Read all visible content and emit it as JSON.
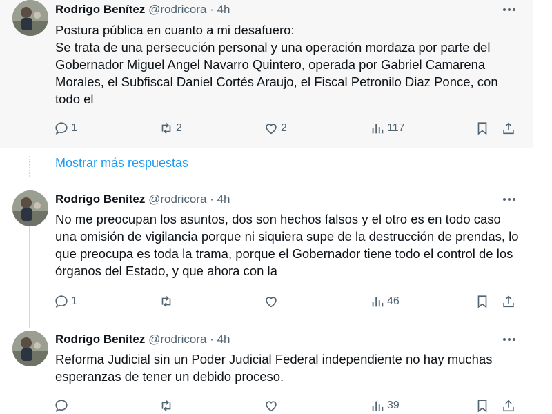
{
  "tweets": [
    {
      "name": "Rodrigo Benítez",
      "handle": "@rodricora",
      "separator": "·",
      "time": "4h",
      "text": "Postura pública en cuanto a mi desafuero:\nSe trata de una persecución personal y una operación mordaza por parte del Gobernador Miguel Angel Navarro Quintero, operada por Gabriel Camarena Morales, el Subfiscal Daniel Cortés Araujo, el Fiscal Petronilo Diaz Ponce, con todo el",
      "replies": "1",
      "reposts": "2",
      "likes": "2",
      "views": "117"
    },
    {
      "name": "Rodrigo Benítez",
      "handle": "@rodricora",
      "separator": "·",
      "time": "4h",
      "text": "No me preocupan los asuntos, dos son hechos falsos y el otro es en todo caso una omisión de vigilancia porque ni siquiera supe de la destrucción de prendas, lo que preocupa es toda la trama, porque el Gobernador tiene todo el control de los órganos del Estado, y que ahora con la",
      "replies": "1",
      "reposts": "",
      "likes": "",
      "views": "46"
    },
    {
      "name": "Rodrigo Benítez",
      "handle": "@rodricora",
      "separator": "·",
      "time": "4h",
      "text": "Reforma Judicial sin un Poder Judicial Federal independiente no hay muchas esperanzas de tener un debido proceso.",
      "replies": "",
      "reposts": "",
      "likes": "",
      "views": "39"
    }
  ],
  "show_more_label": "Mostrar más respuestas",
  "colors": {
    "link": "#1d9bf0",
    "secondary_text": "#536471",
    "thread_line": "#cfd9de",
    "highlight_bg": "#f7f7f7"
  },
  "icons": [
    "reply-icon",
    "repost-icon",
    "like-icon",
    "views-icon",
    "bookmark-icon",
    "share-icon",
    "more-icon"
  ]
}
